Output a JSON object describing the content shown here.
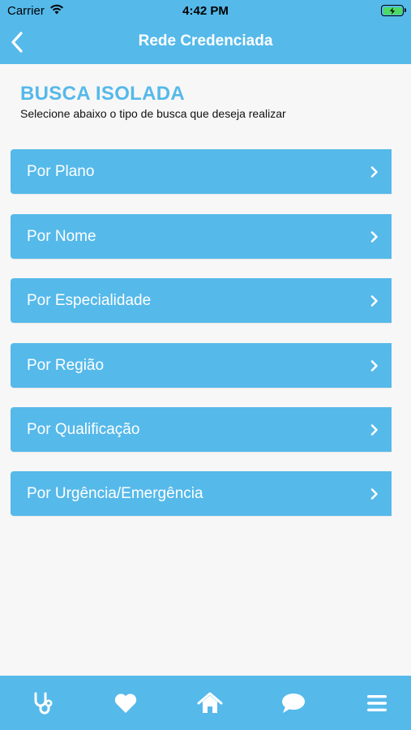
{
  "status_bar": {
    "carrier": "Carrier",
    "time": "4:42 PM"
  },
  "nav": {
    "title": "Rede Credenciada",
    "back_icon": "chevron-left-icon"
  },
  "page": {
    "heading": "BUSCA ISOLADA",
    "subtitle": "Selecione abaixo o tipo de busca que deseja realizar"
  },
  "options": [
    {
      "label": "Por Plano"
    },
    {
      "label": "Por Nome"
    },
    {
      "label": "Por Especialidade"
    },
    {
      "label": "Por Região"
    },
    {
      "label": "Por Qualificação"
    },
    {
      "label": "Por Urgência/Emergência"
    }
  ],
  "tabbar": {
    "items": [
      {
        "icon": "stethoscope-icon"
      },
      {
        "icon": "heart-icon"
      },
      {
        "icon": "home-icon"
      },
      {
        "icon": "chat-bubble-icon"
      },
      {
        "icon": "menu-icon"
      }
    ]
  },
  "colors": {
    "accent": "#55b9ea",
    "background": "#f7f7f7",
    "battery": "#4cd964"
  }
}
